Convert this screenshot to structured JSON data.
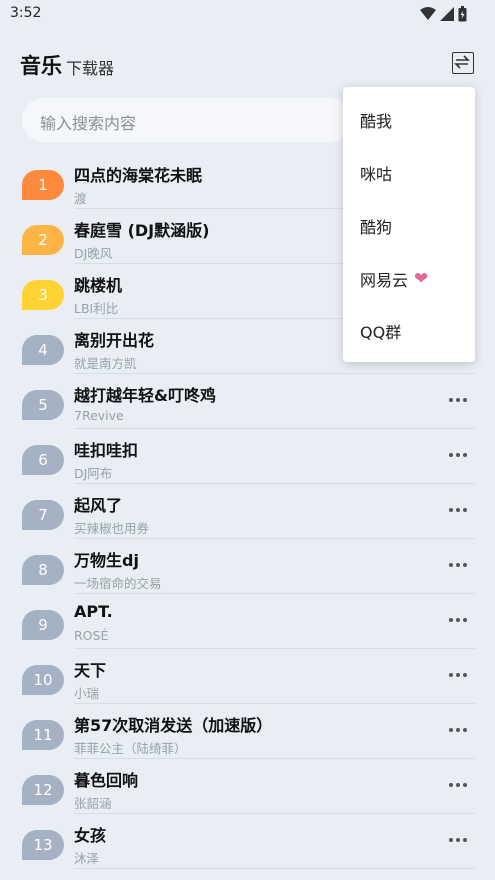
{
  "status": {
    "time": "3:52"
  },
  "header": {
    "title": "音乐",
    "subtitle": "下载器"
  },
  "search": {
    "placeholder": "输入搜索内容"
  },
  "songs": [
    {
      "rank": "1",
      "title": "四点的海棠花未眠",
      "artist": "渡",
      "color": "#ff8a3d"
    },
    {
      "rank": "2",
      "title": "春庭雪 (DJ默涵版)",
      "artist": "DJ晚风",
      "color": "#ffb545"
    },
    {
      "rank": "3",
      "title": "跳楼机",
      "artist": "LBI利比",
      "color": "#ffd233"
    },
    {
      "rank": "4",
      "title": "离别开出花",
      "artist": "就是南方凯",
      "color": "#a4b2c4"
    },
    {
      "rank": "5",
      "title": "越打越年轻&叮咚鸡",
      "artist": "7Revive",
      "color": "#a4b2c4"
    },
    {
      "rank": "6",
      "title": "哇扣哇扣",
      "artist": "DJ阿布",
      "color": "#a4b2c4"
    },
    {
      "rank": "7",
      "title": "起风了",
      "artist": "买辣椒也用券",
      "color": "#a4b2c4"
    },
    {
      "rank": "8",
      "title": "万物生dj",
      "artist": "一场宿命的交易",
      "color": "#a4b2c4"
    },
    {
      "rank": "9",
      "title": "APT.",
      "artist": "ROSÉ",
      "color": "#a4b2c4"
    },
    {
      "rank": "10",
      "title": "天下",
      "artist": "小瑞",
      "color": "#a4b2c4"
    },
    {
      "rank": "11",
      "title": "第57次取消发送（加速版）",
      "artist": "菲菲公主（陆绮菲）",
      "color": "#a4b2c4"
    },
    {
      "rank": "12",
      "title": "暮色回响",
      "artist": "张韶涵",
      "color": "#a4b2c4"
    },
    {
      "rank": "13",
      "title": "女孩",
      "artist": "沐泽",
      "color": "#a4b2c4"
    }
  ],
  "menu": {
    "items": [
      {
        "label": "酷我"
      },
      {
        "label": "咪咕"
      },
      {
        "label": "酷狗"
      },
      {
        "label": "网易云",
        "icon": "heart-icon"
      },
      {
        "label": "QQ群"
      }
    ]
  }
}
